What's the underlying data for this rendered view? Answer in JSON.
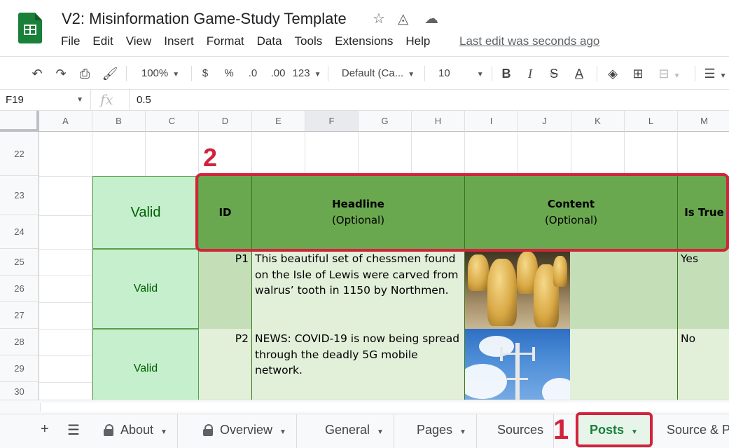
{
  "document": {
    "title": "V2: Misinformation Game-Study Template",
    "last_edit": "Last edit was seconds ago"
  },
  "icons": {
    "star": "star-icon",
    "drive_status": "move-to-drive-icon",
    "cloud_saved": "cloud-saved-icon"
  },
  "menu": [
    "File",
    "Edit",
    "View",
    "Insert",
    "Format",
    "Data",
    "Tools",
    "Extensions",
    "Help"
  ],
  "toolbar": {
    "zoom": "100%",
    "currency": "$",
    "percent": "%",
    "decrease_decimals": ".0",
    "increase_decimals": ".00",
    "more_formats": "123",
    "font": "Default (Ca...",
    "font_size": "10",
    "bold": "B",
    "italic": "I",
    "strikethrough": "S",
    "text_color": "A"
  },
  "formula_bar": {
    "cell_ref": "F19",
    "fx": "fx",
    "value": "0.5"
  },
  "columns": [
    "A",
    "B",
    "C",
    "D",
    "E",
    "F",
    "G",
    "H",
    "I",
    "J",
    "K",
    "L",
    "M"
  ],
  "rows": [
    "22",
    "23",
    "24",
    "25",
    "26",
    "27",
    "28",
    "29",
    "30"
  ],
  "sheet": {
    "header_valid": "Valid",
    "headers": {
      "id": "ID",
      "headline": "Headline",
      "headline_sub": "(Optional)",
      "content": "Content",
      "content_sub": "(Optional)",
      "is_true": "Is True"
    },
    "posts": [
      {
        "valid": "Valid",
        "id": "P1",
        "headline": "This beautiful set of chessmen found on the Isle of Lewis were carved from walrus’ tooth in 1150 by Northmen.",
        "content_image": "lewis-chessmen-image",
        "is_true": "Yes"
      },
      {
        "valid": "Valid",
        "id": "P2",
        "headline": "NEWS: COVID-19 is now being spread through the deadly 5G mobile network.",
        "content_image": "cell-tower-image",
        "is_true": "No"
      }
    ]
  },
  "annotations": {
    "step1": "1",
    "step2": "2",
    "highlight_color": "#d2233c"
  },
  "tabs": [
    {
      "label": "About",
      "locked": true
    },
    {
      "label": "Overview",
      "locked": true
    },
    {
      "label": "General",
      "locked": false
    },
    {
      "label": "Pages",
      "locked": false
    },
    {
      "label": "Sources",
      "locked": false
    },
    {
      "label": "Posts",
      "locked": false,
      "active": true
    },
    {
      "label": "Source & P",
      "locked": false
    }
  ],
  "colors": {
    "brand_green": "#188038",
    "header_green": "#6aa84f",
    "valid_fill": "#c6efce",
    "valid_text": "#006100"
  }
}
